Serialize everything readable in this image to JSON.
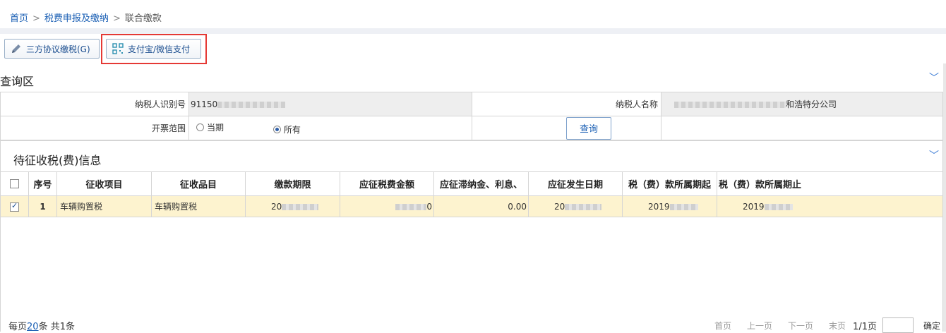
{
  "breadcrumb": {
    "home": "首页",
    "parent": "税费申报及缴纳",
    "current": "联合缴款"
  },
  "toolbar": {
    "tripartite_label": "三方协议缴税(G)",
    "qr_pay_label": "支付宝/微信支付"
  },
  "query": {
    "title": "查询区",
    "taxpayer_id_label": "纳税人识别号",
    "taxpayer_id_value": "91150",
    "taxpayer_name_label": "纳税人名称",
    "taxpayer_name_suffix": "和浩特分公司",
    "invoice_range_label": "开票范围",
    "options": [
      "当期",
      "所有"
    ],
    "selected": "所有",
    "search_button": "查询"
  },
  "pending": {
    "title": "待征收税(费)信息",
    "columns": [
      "序号",
      "征收项目",
      "征收品目",
      "缴款期限",
      "应征税费金额",
      "应征滞纳金、利息、",
      "应征发生日期",
      "税（费）款所属期起",
      "税（费）款所属期止"
    ],
    "rows": [
      {
        "checked": true,
        "index": "1",
        "item": "车辆购置税",
        "category": "车辆购置税",
        "deadline": "20",
        "amount_tail": "0",
        "late_fee": "0.00",
        "occur_date": "20",
        "period_start": "2019",
        "period_end": "2019"
      }
    ]
  },
  "footer": {
    "per_page_prefix": "每页",
    "per_page_value": "20",
    "per_page_suffix": "条 共1条",
    "first": "首页",
    "prev": "上一页",
    "next": "下一页",
    "last": "末页",
    "page_info": "1/1页",
    "confirm": "确定"
  }
}
